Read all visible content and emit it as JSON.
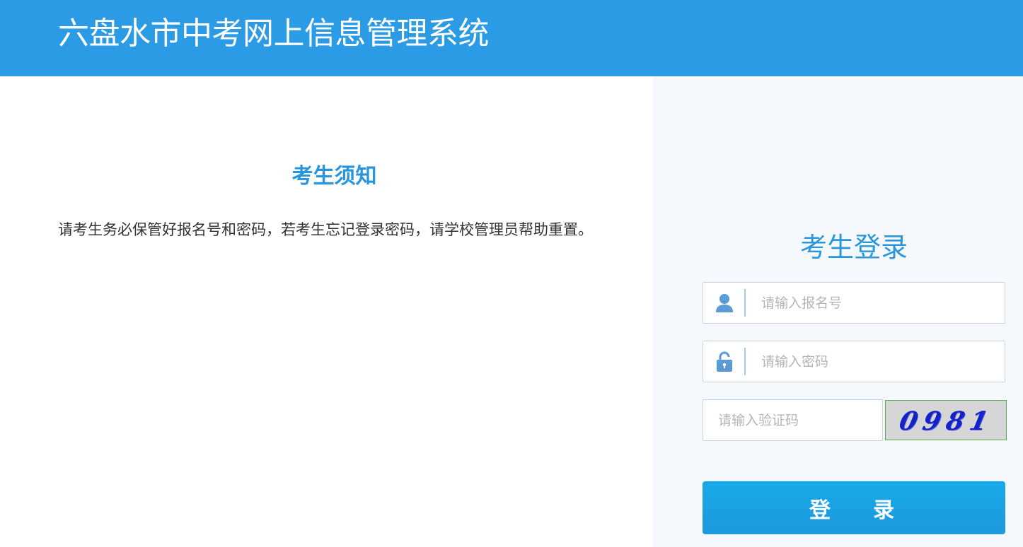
{
  "header": {
    "title": "六盘水市中考网上信息管理系统"
  },
  "notice": {
    "title": "考生须知",
    "body": "请考生务必保管好报名号和密码，若考生忘记登录密码，请学校管理员帮助重置。"
  },
  "login": {
    "title": "考生登录",
    "username_placeholder": "请输入报名号",
    "username_value": "",
    "password_placeholder": "请输入密码",
    "password_value": "",
    "captcha_placeholder": "请输入验证码",
    "captcha_value": "",
    "captcha_image_text": "0981",
    "submit_label": "登录"
  },
  "colors": {
    "header_bg": "#2b9be6",
    "accent_text": "#2795dc",
    "panel_bg": "#f5f9fd",
    "button_bg": "#1aa2e5",
    "icon": "#5b9bd5"
  },
  "icons": {
    "username": "user-icon",
    "password": "lock-icon"
  }
}
